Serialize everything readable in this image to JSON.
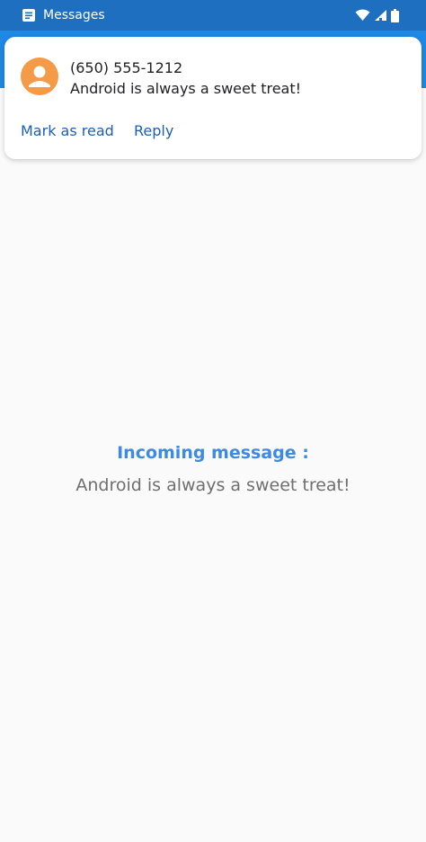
{
  "status_bar": {
    "app_name": "Messages",
    "icons": [
      "message-icon",
      "wifi-icon",
      "cell-signal-icon",
      "battery-icon"
    ],
    "color": "#1e6fbf"
  },
  "app_bar": {
    "color": "#1e88e5"
  },
  "notification": {
    "avatar_icon": "person-icon",
    "avatar_color": "#f59a47",
    "sender": "(650) 555-1212",
    "message": "Android is always a sweet treat!",
    "actions": {
      "mark_as_read": "Mark as read",
      "reply": "Reply"
    },
    "action_color": "#1a5fb4"
  },
  "main": {
    "title": "Incoming message :",
    "message": "Android is always a sweet treat!",
    "title_color": "#3f8ae0"
  }
}
